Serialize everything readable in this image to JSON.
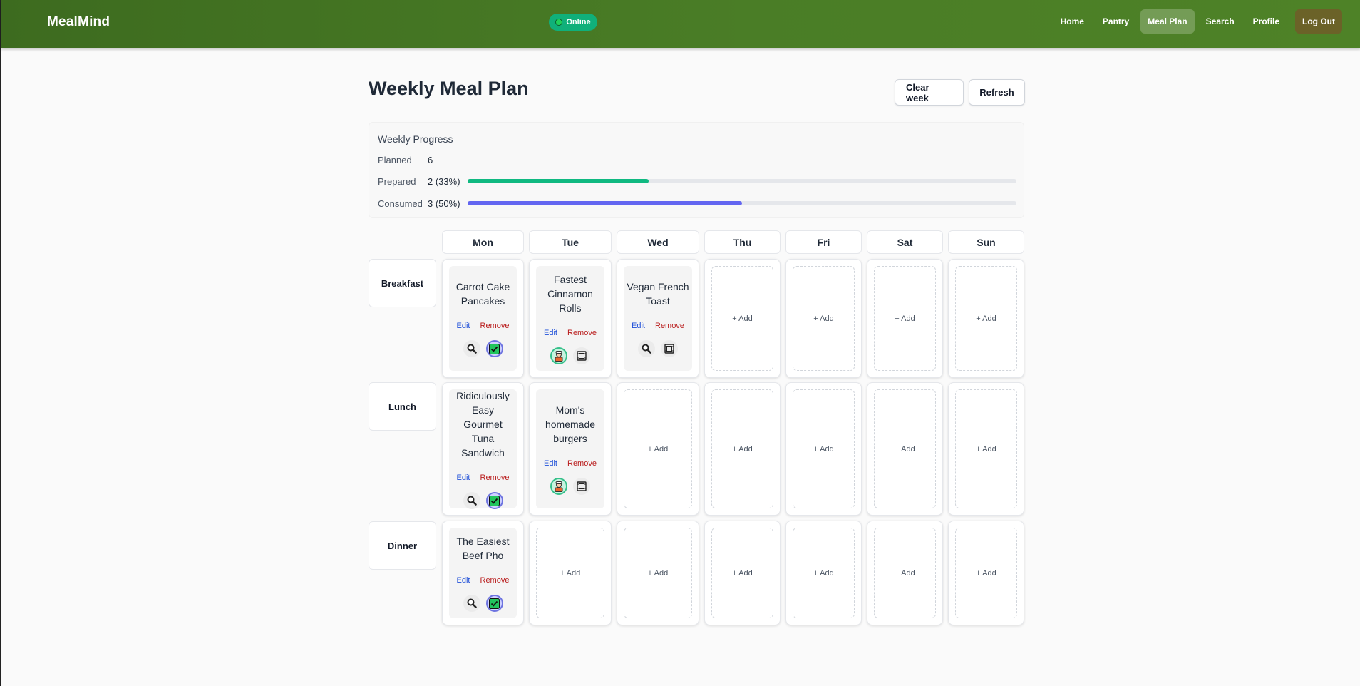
{
  "nav": {
    "brand": "MealMind",
    "status": "Online",
    "links": [
      "Home",
      "Pantry",
      "Meal Plan",
      "Search",
      "Profile",
      "Log Out"
    ],
    "active": "Meal Plan"
  },
  "page": {
    "title": "Weekly Meal Plan",
    "clear_label": "Clear week",
    "refresh_label": "Refresh"
  },
  "progress": {
    "title": "Weekly Progress",
    "planned_label": "Planned",
    "planned_value": "6",
    "prepared_label": "Prepared",
    "prepared_value": "2 (33%)",
    "prepared_fraction": 0.33,
    "consumed_label": "Consumed",
    "consumed_value": "3 (50%)",
    "consumed_fraction": 0.5,
    "prepared_color": "#10b981",
    "consumed_color": "#6366f1"
  },
  "days": [
    "Mon",
    "Tue",
    "Wed",
    "Thu",
    "Fri",
    "Sat",
    "Sun"
  ],
  "meals": [
    "Breakfast",
    "Lunch",
    "Dinner"
  ],
  "add_label": "+ Add",
  "edit_label": "Edit",
  "remove_label": "Remove",
  "plan": {
    "breakfast": [
      {
        "name_lines": [
          "Carrot Cake",
          "Pancakes"
        ],
        "icons": [
          "magnifier-icon",
          "checkbox-checked-icon"
        ]
      },
      {
        "name_lines": [
          "Fastest",
          "Cinnamon",
          "Rolls"
        ],
        "icons": [
          "chef-icon",
          "film-frame-icon"
        ]
      },
      {
        "name_lines": [
          "Vegan French",
          "Toast"
        ],
        "icons": [
          "magnifier-icon",
          "film-frame-icon"
        ]
      },
      null,
      null,
      null,
      null
    ],
    "lunch": [
      {
        "name_lines": [
          "Ridiculously",
          "Easy Gourmet",
          "Tuna",
          "Sandwich"
        ],
        "icons": [
          "magnifier-icon",
          "checkbox-checked-icon"
        ]
      },
      {
        "name_lines": [
          "Mom's",
          "homemade",
          "burgers"
        ],
        "icons": [
          "chef-icon",
          "film-frame-icon"
        ]
      },
      null,
      null,
      null,
      null,
      null
    ],
    "dinner": [
      {
        "name_lines": [
          "The Easiest",
          "Beef Pho"
        ],
        "icons": [
          "magnifier-icon",
          "checkbox-checked-icon"
        ]
      },
      null,
      null,
      null,
      null,
      null,
      null
    ]
  }
}
